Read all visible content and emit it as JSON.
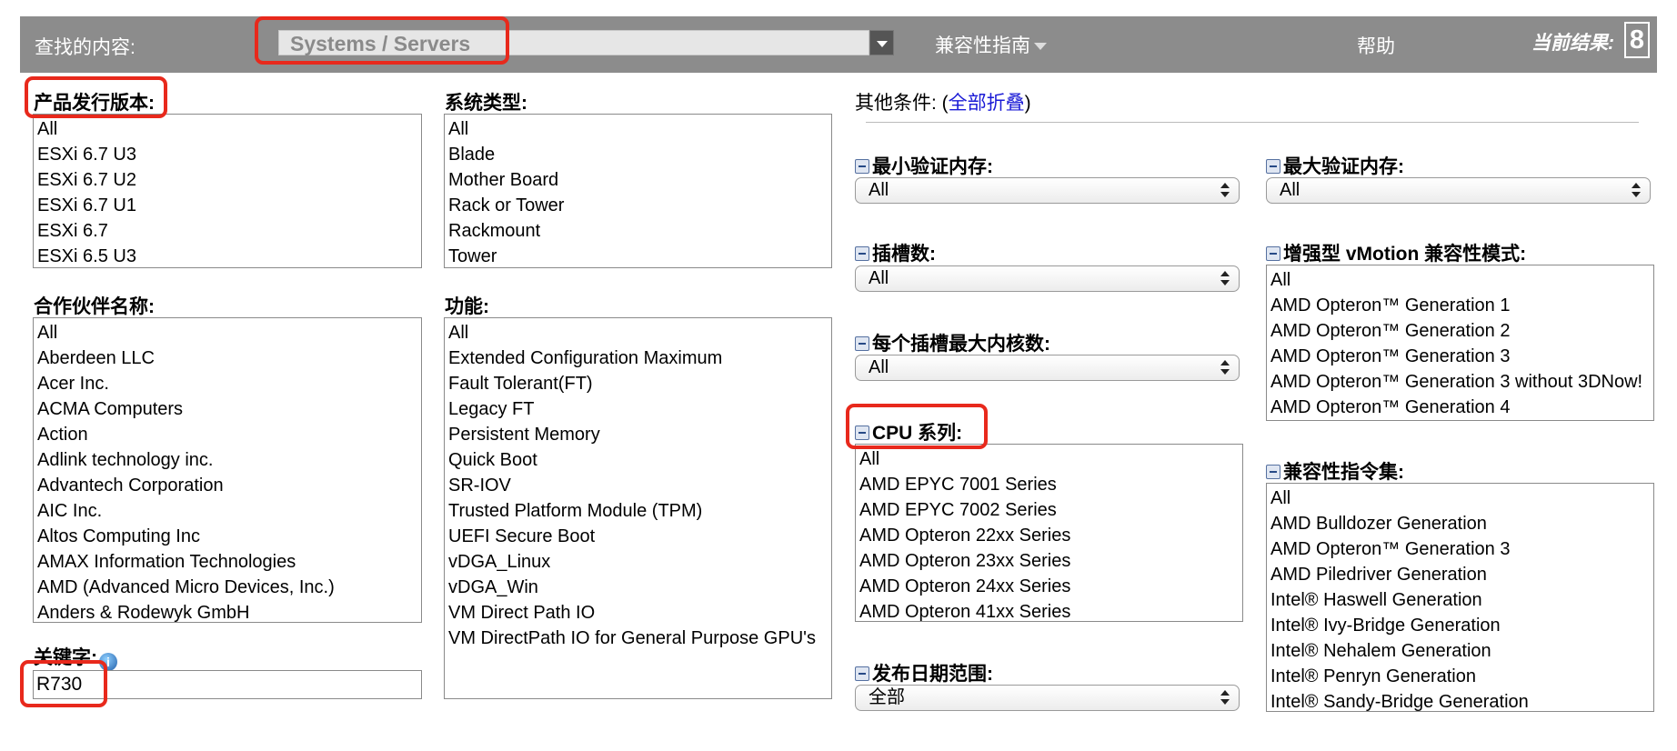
{
  "header": {
    "search_label": "查找的内容:",
    "search_value": "Systems / Servers",
    "nav_guide": "兼容性指南",
    "nav_help": "帮助",
    "result_label": "当前结果:",
    "result_count": "8"
  },
  "release": {
    "title": "产品发行版本:",
    "items": [
      "All",
      "ESXi 6.7 U3",
      "ESXi 6.7 U2",
      "ESXi 6.7 U1",
      "ESXi 6.7",
      "ESXi 6.5 U3"
    ]
  },
  "system_type": {
    "title": "系统类型:",
    "items": [
      "All",
      "Blade",
      "Mother Board",
      "Rack or Tower",
      "Rackmount",
      "Tower"
    ]
  },
  "partner": {
    "title": "合作伙伴名称:",
    "items": [
      "All",
      "Aberdeen LLC",
      "Acer Inc.",
      "ACMA Computers",
      "Action",
      "Adlink technology inc.",
      "Advantech Corporation",
      "AIC Inc.",
      "Altos Computing Inc",
      "AMAX Information Technologies",
      "AMD (Advanced Micro Devices, Inc.)",
      "Anders & Rodewyk GmbH"
    ]
  },
  "features": {
    "title": "功能:",
    "items": [
      "All",
      "Extended Configuration Maximum",
      "Fault Tolerant(FT)",
      "Legacy FT",
      "Persistent Memory",
      "Quick Boot",
      "SR-IOV",
      "Trusted Platform Module (TPM)",
      "UEFI Secure Boot",
      "vDGA_Linux",
      "vDGA_Win",
      "VM Direct Path IO",
      "VM DirectPath IO for General Purpose GPU's"
    ]
  },
  "keyword": {
    "title": "关键字:",
    "value": "R730"
  },
  "other": {
    "prefix": "其他条件: (",
    "collapse_link": "全部折叠",
    "suffix": ")"
  },
  "min_memory": {
    "title": "最小验证内存:",
    "value": "All"
  },
  "max_memory": {
    "title": "最大验证内存:",
    "value": "All"
  },
  "sockets": {
    "title": "插槽数:",
    "value": "All"
  },
  "evc": {
    "title": "增强型 vMotion 兼容性模式:",
    "items": [
      "All",
      "AMD Opteron™ Generation 1",
      "AMD Opteron™ Generation 2",
      "AMD Opteron™ Generation 3",
      "AMD Opteron™ Generation 3 without 3DNow!",
      "AMD Opteron™ Generation 4"
    ]
  },
  "cores": {
    "title": "每个插槽最大内核数:",
    "value": "All"
  },
  "cpu": {
    "title": "CPU 系列:",
    "items": [
      "All",
      "AMD EPYC 7001 Series",
      "AMD EPYC 7002 Series",
      "AMD Opteron 22xx Series",
      "AMD Opteron 23xx Series",
      "AMD Opteron 24xx Series",
      "AMD Opteron 41xx Series"
    ]
  },
  "isa": {
    "title": "兼容性指令集:",
    "items": [
      "All",
      "AMD Bulldozer Generation",
      "AMD Opteron™ Generation 3",
      "AMD Piledriver Generation",
      "Intel® Haswell Generation",
      "Intel® Ivy-Bridge Generation",
      "Intel® Nehalem Generation",
      "Intel® Penryn Generation",
      "Intel® Sandy-Bridge Generation"
    ]
  },
  "release_date": {
    "title": "发布日期范围:",
    "value": "全部"
  }
}
